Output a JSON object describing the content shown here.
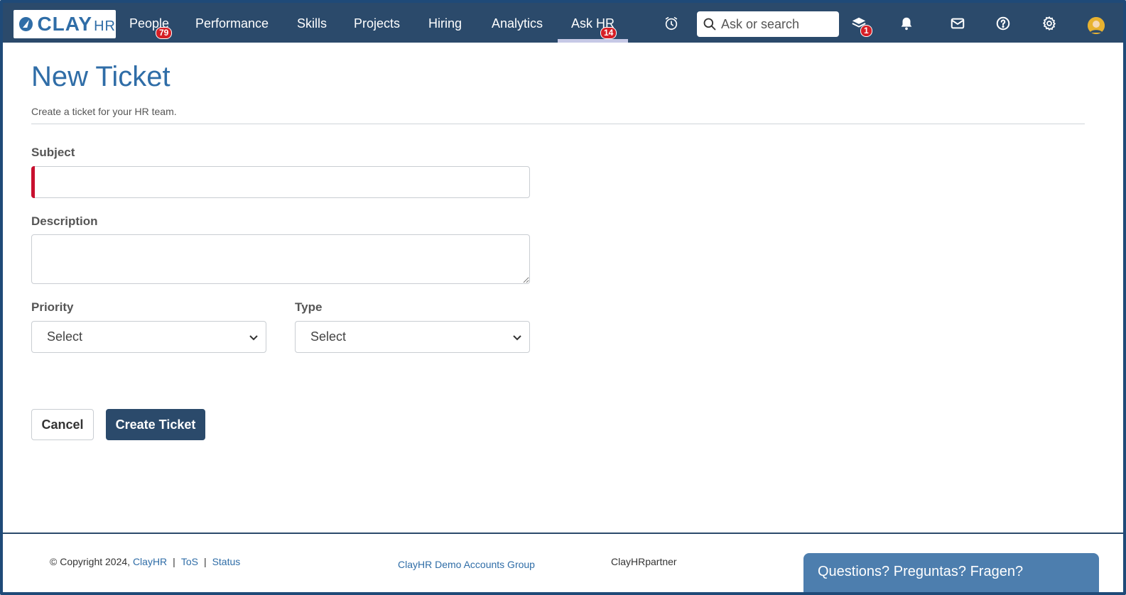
{
  "nav": {
    "logo_main": "CLAY",
    "logo_sub": "HR",
    "items": [
      {
        "label": "People",
        "badge": "79"
      },
      {
        "label": "Performance"
      },
      {
        "label": "Skills"
      },
      {
        "label": "Projects"
      },
      {
        "label": "Hiring"
      },
      {
        "label": "Analytics"
      },
      {
        "label": "Ask HR",
        "badge": "14",
        "active": true
      }
    ],
    "search_placeholder": "Ask or search",
    "learning_badge": "1",
    "icons": [
      "alarm-clock-icon",
      "search-icon",
      "learning-stack-icon",
      "bell-icon",
      "mail-icon",
      "help-icon",
      "gear-icon",
      "avatar"
    ],
    "colors": {
      "nav_bg": "#2b4a6b",
      "accent": "#2f6da7",
      "badge": "#d61f26",
      "required": "#c8102e"
    }
  },
  "page": {
    "title": "New Ticket",
    "subtitle": "Create a ticket for your HR team."
  },
  "form": {
    "subject_label": "Subject",
    "subject_value": "",
    "description_label": "Description",
    "description_value": "",
    "priority_label": "Priority",
    "priority_value": "Select",
    "type_label": "Type",
    "type_value": "Select",
    "cancel_label": "Cancel",
    "create_label": "Create Ticket"
  },
  "footer": {
    "copyright": "© Copyright 2024,",
    "brand_link": "ClayHR",
    "tos": "ToS",
    "status": "Status",
    "group_link": "ClayHR Demo Accounts Group",
    "partner": "ClayHRpartner",
    "chat": "Questions? Preguntas? Fragen?"
  }
}
